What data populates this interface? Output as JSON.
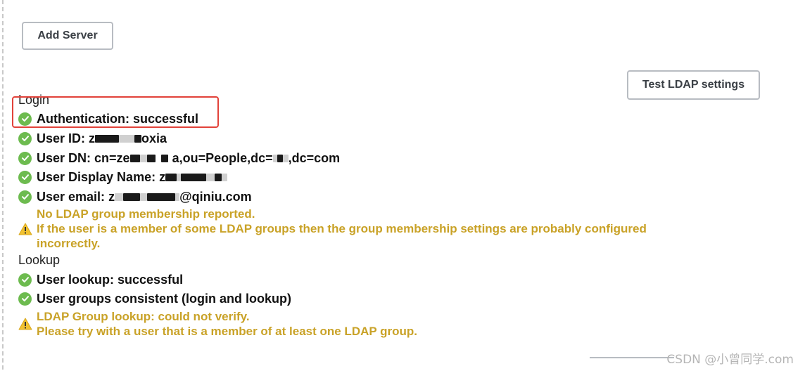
{
  "buttons": {
    "add_server": "Add Server",
    "test_ldap": "Test LDAP settings"
  },
  "login": {
    "title": "Login",
    "rows": [
      "Authentication: successful",
      "User ID: ",
      "User DN: cn=",
      "User Display Name: ",
      "User email: "
    ],
    "user_id_suffix": "oxia",
    "user_dn_suffix": "a,ou=People,dc=",
    "user_dn_end": ",dc=com",
    "user_email_suffix": "@qiniu.com",
    "user_email_prefix": "z",
    "user_dn_prefix": "ze",
    "user_id_prefix": "z",
    "display_name_prefix": "z",
    "warning_lines": [
      "No LDAP group membership reported.",
      "If the user is a member of some LDAP groups then the group membership settings are probably configured",
      "incorrectly."
    ]
  },
  "lookup": {
    "title": "Lookup",
    "rows": [
      "User lookup: successful",
      "User groups consistent (login and lookup)"
    ],
    "warning_lines": [
      "LDAP Group lookup: could not verify.",
      "Please try with a user that is a member of at least one LDAP group."
    ]
  },
  "watermark": "CSDN @小曾同学.com",
  "colors": {
    "success": "#6dbb4f",
    "warning": "#c9a227",
    "highlight": "#e2423a"
  }
}
